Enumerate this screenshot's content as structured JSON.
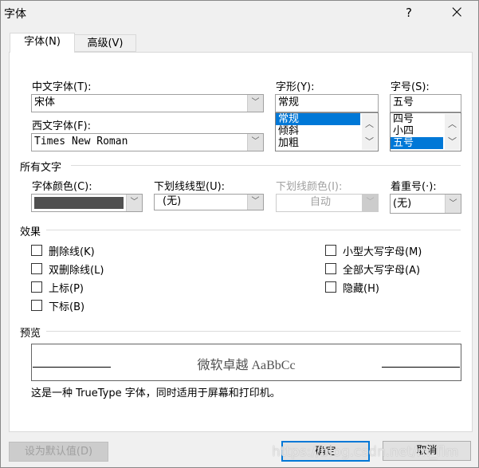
{
  "window": {
    "title": "字体",
    "help": "?",
    "close": "×"
  },
  "tabs": [
    {
      "label": "字体(N)",
      "active": true
    },
    {
      "label": "高级(V)",
      "active": false
    }
  ],
  "font": {
    "chinese_label": "中文字体(T):",
    "chinese_value": "宋体",
    "western_label": "西文字体(F):",
    "western_value": "Times New Roman",
    "style_label": "字形(Y):",
    "style_value": "常规",
    "style_options": [
      "常规",
      "倾斜",
      "加粗"
    ],
    "style_selected": "常规",
    "size_label": "字号(S):",
    "size_value": "五号",
    "size_options": [
      "四号",
      "小四",
      "五号"
    ],
    "size_selected": "五号"
  },
  "all_text": {
    "heading": "所有文字",
    "color_label": "字体颜色(C):",
    "color_value": "#505050",
    "underline_label": "下划线线型(U):",
    "underline_value": "(无)",
    "underline_color_label": "下划线颜色(I):",
    "underline_color_value": "自动",
    "emphasis_label": "着重号(·):",
    "emphasis_value": "(无)"
  },
  "effects": {
    "heading": "效果",
    "left": [
      {
        "label": "删除线(K)",
        "checked": false
      },
      {
        "label": "双删除线(L)",
        "checked": false
      },
      {
        "label": "上标(P)",
        "checked": false
      },
      {
        "label": "下标(B)",
        "checked": false
      }
    ],
    "right": [
      {
        "label": "小型大写字母(M)",
        "checked": false
      },
      {
        "label": "全部大写字母(A)",
        "checked": false
      },
      {
        "label": "隐藏(H)",
        "checked": false
      }
    ]
  },
  "preview": {
    "heading": "预览",
    "sample": "微软卓越 AaBbCc",
    "description": "这是一种 TrueType 字体，同时适用于屏幕和打印机。"
  },
  "buttons": {
    "default": "设为默认值(D)",
    "ok": "确定",
    "cancel": "取消"
  },
  "watermark": "https://blog.csdn.net/m_flm",
  "colors": {
    "accent": "#0078d7"
  }
}
